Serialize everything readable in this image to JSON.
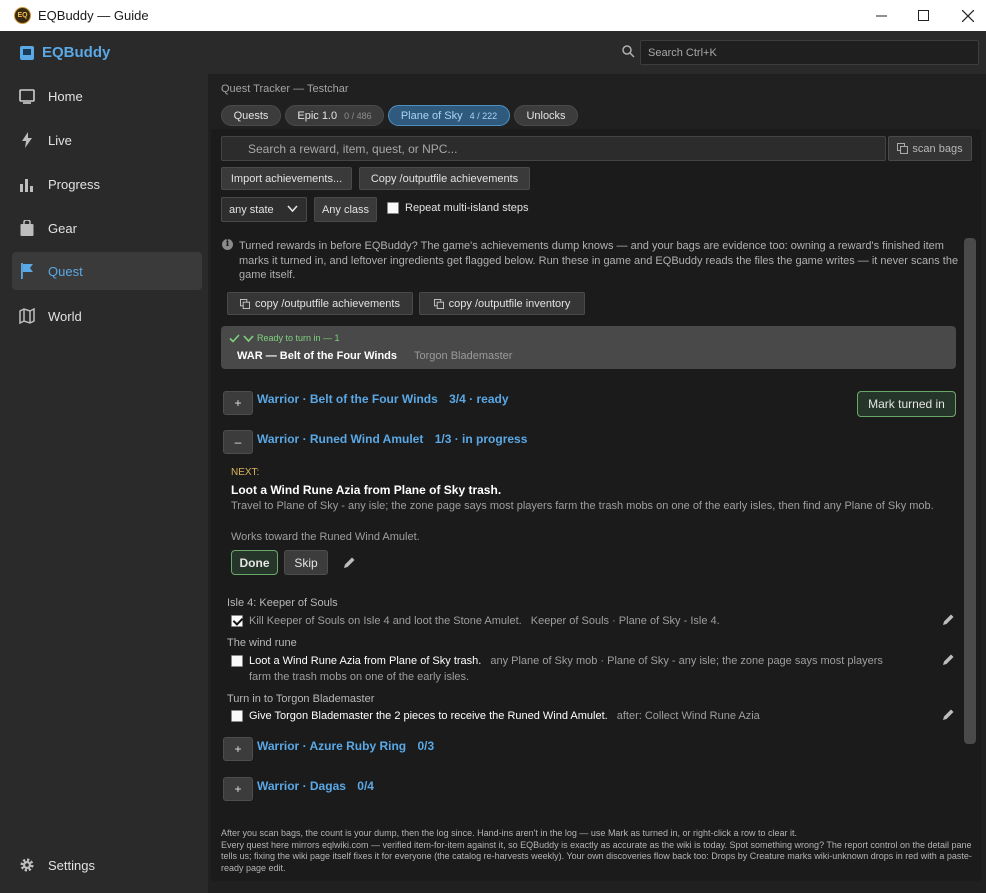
{
  "window": {
    "title": "EQBuddy — Guide"
  },
  "brand": {
    "name": "EQBuddy"
  },
  "search_top": {
    "placeholder": "Search  Ctrl+K"
  },
  "sidebar": {
    "items": [
      {
        "label": "Home",
        "icon": "home-icon"
      },
      {
        "label": "Live",
        "icon": "bolt-icon"
      },
      {
        "label": "Progress",
        "icon": "bar-chart-icon"
      },
      {
        "label": "Gear",
        "icon": "bag-icon"
      },
      {
        "label": "Quest",
        "icon": "flag-icon",
        "active": true
      },
      {
        "label": "World",
        "icon": "map-icon"
      }
    ],
    "settings_label": "Settings"
  },
  "breadcrumb": "Quest Tracker — Testchar",
  "tabs": [
    {
      "label": "Quests",
      "count": ""
    },
    {
      "label": "Epic 1.0",
      "count": "0 / 486"
    },
    {
      "label": "Plane of Sky",
      "count": "4 / 222",
      "active": true
    },
    {
      "label": "Unlocks",
      "count": ""
    }
  ],
  "search_main": {
    "placeholder": "Search a reward, item, quest, or NPC..."
  },
  "scan_bags_label": "scan bags",
  "buttons": {
    "import_achievements": "Import achievements...",
    "copy_outputfile_achievements": "Copy /outputfile achievements"
  },
  "filters": {
    "state": "any state",
    "class": "Any class",
    "repeat_label": "Repeat multi-island steps",
    "repeat_checked": false
  },
  "info": {
    "text": "Turned rewards in before EQBuddy? The game's achievements dump knows — and your bags are evidence too: owning a reward's finished item marks it turned in, and leftover ingredients get flagged below. Run these in game and EQBuddy reads the files the game writes — it never scans the game itself.",
    "copy_achievements": "copy  /outputfile achievements",
    "copy_inventory": "copy  /outputfile inventory"
  },
  "ready": {
    "header": "Ready to turn in — 1",
    "item": "WAR — Belt of the Four Winds",
    "npc": "Torgon Blademaster"
  },
  "quests": [
    {
      "toggle": "+",
      "title": "Warrior · Belt of the Four Winds",
      "progress": "3/4",
      "status": "· ready"
    },
    {
      "toggle": "–",
      "title": "Warrior · Runed Wind Amulet",
      "progress": "1/3",
      "status": "· in progress"
    },
    {
      "toggle": "+",
      "title": "Warrior · Azure Ruby Ring",
      "progress": "0/3",
      "status": ""
    },
    {
      "toggle": "+",
      "title": "Warrior · Dagas",
      "progress": "0/4",
      "status": ""
    }
  ],
  "mark_turned_in": "Mark turned in",
  "next": {
    "label": "NEXT:",
    "title": "Loot a Wind Rune Azia from Plane of Sky trash.",
    "desc": "Travel to Plane of Sky - any isle; the zone page says most players farm the trash mobs on one of the early isles, then find any Plane of Sky mob.",
    "works": "Works toward the Runed Wind Amulet.",
    "done": "Done",
    "skip": "Skip"
  },
  "steps": [
    {
      "group": "Isle 4: Keeper of Souls",
      "text": "Kill Keeper of Souls on Isle 4 and loot the Stone Amulet.",
      "meta": "Keeper of Souls · Plane of Sky - Isle 4.",
      "checked": true
    },
    {
      "group": "The wind rune",
      "text": "Loot a Wind Rune Azia from Plane of Sky trash.",
      "meta": "any Plane of Sky mob · Plane of Sky - any isle; the zone page says most players",
      "meta2": "farm the trash mobs on one of the early isles.",
      "checked": false
    },
    {
      "group": "Turn in to Torgon Blademaster",
      "text": "Give Torgon Blademaster the 2 pieces to receive the Runed Wind Amulet.",
      "meta": "after: Collect Wind Rune Azia",
      "checked": false
    }
  ],
  "footer": {
    "line1": "After you scan bags, the count is your dump, then the log since. Hand-ins aren't in the log — use Mark as turned in, or right-click a row to clear it.",
    "line2": "Every quest here mirrors eqlwiki.com — verified item-for-item against it, so EQBuddy is exactly as accurate as the wiki is today. Spot something wrong? The report control on the detail pane tells us; fixing the wiki page itself fixes it for everyone (the catalog re-harvests weekly). Your own discoveries flow back too: Drops by Creature marks wiki-unknown drops in red with a paste-ready page edit."
  },
  "colors": {
    "accent": "#5aa8e6",
    "ready_green": "#7fd17f",
    "next_gold": "#d8b45a"
  }
}
